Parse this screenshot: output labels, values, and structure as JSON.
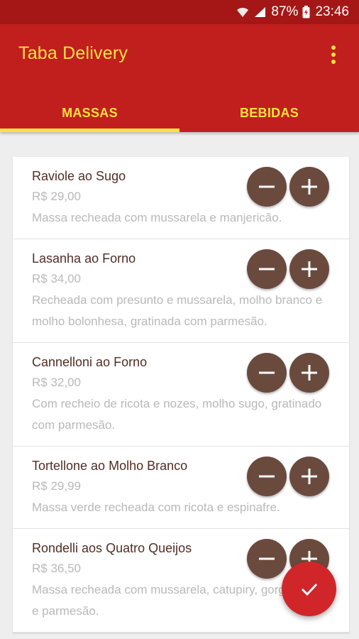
{
  "status_bar": {
    "battery": "87%",
    "time": "23:46"
  },
  "app_bar": {
    "title": "Taba Delivery",
    "menu_icon": "more-vert-icon"
  },
  "tabs": [
    {
      "label": "MASSAS",
      "selected": true
    },
    {
      "label": "BEBIDAS",
      "selected": false
    }
  ],
  "items": [
    {
      "name": "Raviole ao Sugo",
      "price": "R$ 29,00",
      "description": "Massa recheada com mussarela e manjericão."
    },
    {
      "name": "Lasanha ao Forno",
      "price": "R$ 34,00",
      "description": "Recheada com presunto e mussarela, molho branco e molho bolonhesa, gratinada com parmesão."
    },
    {
      "name": "Cannelloni ao Forno",
      "price": "R$ 32,00",
      "description": "Com recheio de ricota e nozes, molho sugo, gratinado com parmesão."
    },
    {
      "name": "Tortellone ao Molho Branco",
      "price": "R$ 29,99",
      "description": "Massa verde recheada com ricota e espinafre."
    },
    {
      "name": "Rondelli aos Quatro Queijos",
      "price": "R$ 36,50",
      "description": "Massa recheada com mussarela, catupiry, gorgonzola e parmesão."
    }
  ],
  "fab": {
    "icon": "check-icon"
  },
  "colors": {
    "status_bar": "#a51717",
    "app_bar": "#c01f1d",
    "accent": "#ffe342",
    "item_button": "#6b4a3e",
    "fab": "#d0262a"
  }
}
